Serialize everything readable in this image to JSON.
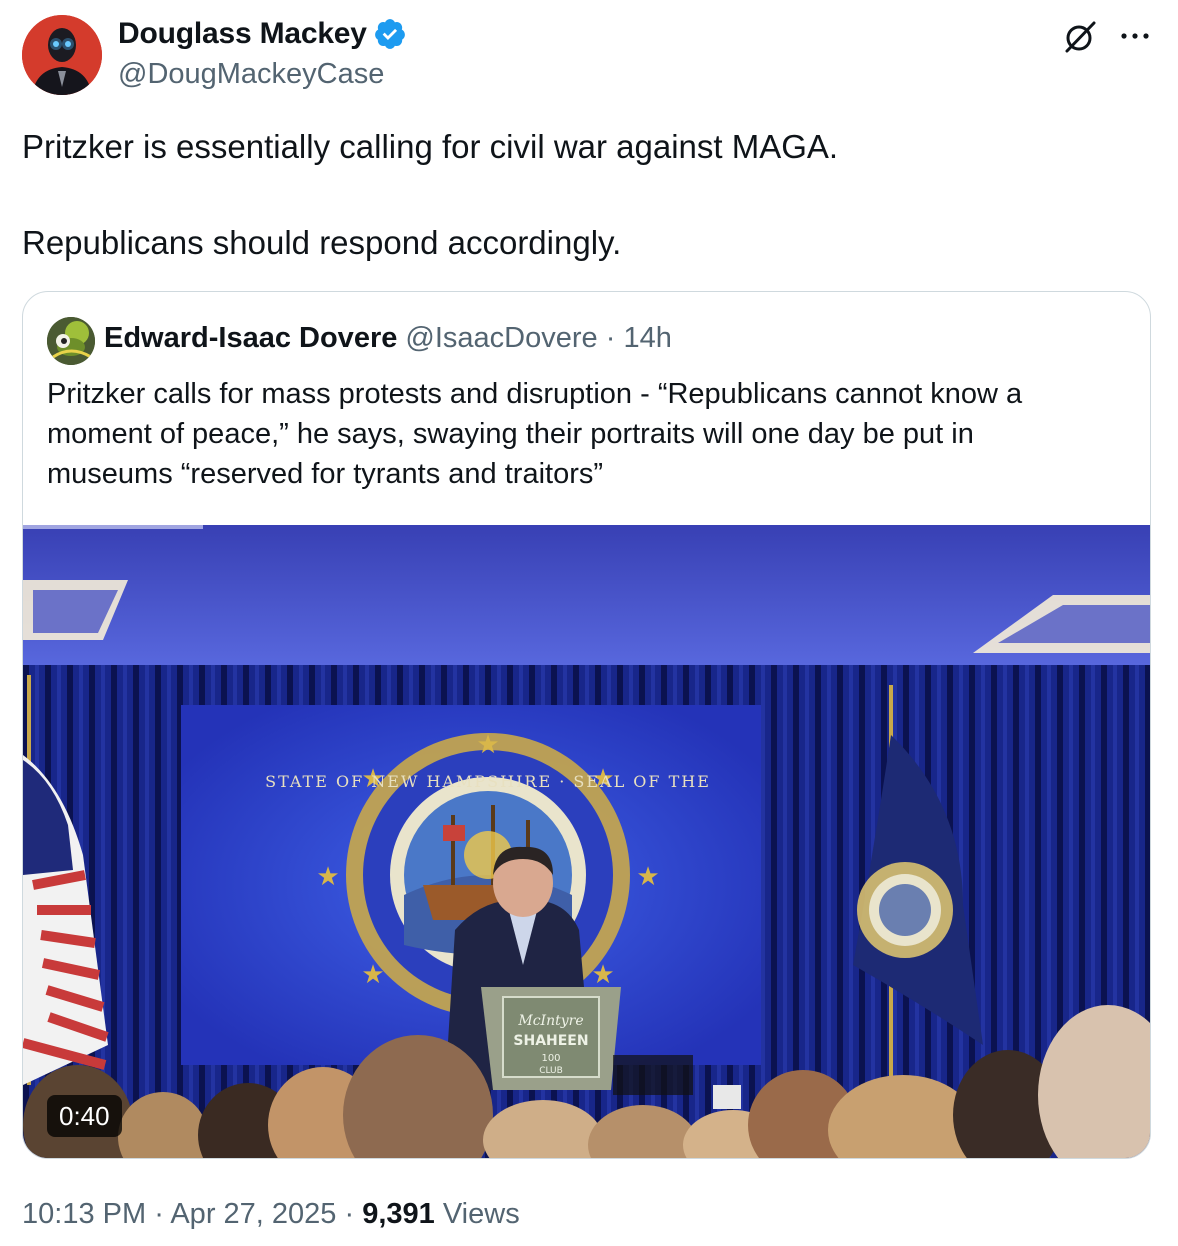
{
  "author": {
    "display_name": "Douglass Mackey",
    "handle": "@DougMackeyCase",
    "avatar_icon": "avatar-laser-eyes",
    "verified_icon": "verified-badge-icon"
  },
  "toolbar": {
    "grok_icon": "grok-icon",
    "more_icon": "more-options-icon"
  },
  "tweet": {
    "paragraphs": [
      "Pritzker is essentially calling for civil war against MAGA.",
      "Republicans should respond accordingly."
    ]
  },
  "quoted_tweet": {
    "display_name": "Edward-Isaac Dovere",
    "handle": "@IsaacDovere",
    "separator": "·",
    "time_ago": "14h",
    "text_lines": [
      "Pritzker calls for mass protests and disruption - “Republicans cannot know a",
      "moment of peace,” he says, swaying their portraits will one day be put in",
      "museums “reserved for tyrants and traitors”"
    ],
    "video": {
      "duration": "0:40",
      "podium_text": [
        "McIntyre",
        "SHAHEEN",
        "100",
        "CLUB"
      ],
      "seal_text": "STATE OF NEW HAMPSHIRE · SEAL OF THE"
    }
  },
  "footer": {
    "time": "10:13 PM",
    "separator": "·",
    "date": "Apr 27, 2025",
    "views_count": "9,391",
    "views_label": "Views"
  },
  "colors": {
    "link_blue": "#1d9bf0",
    "secondary_text": "#536471",
    "border": "#cfd9de"
  }
}
